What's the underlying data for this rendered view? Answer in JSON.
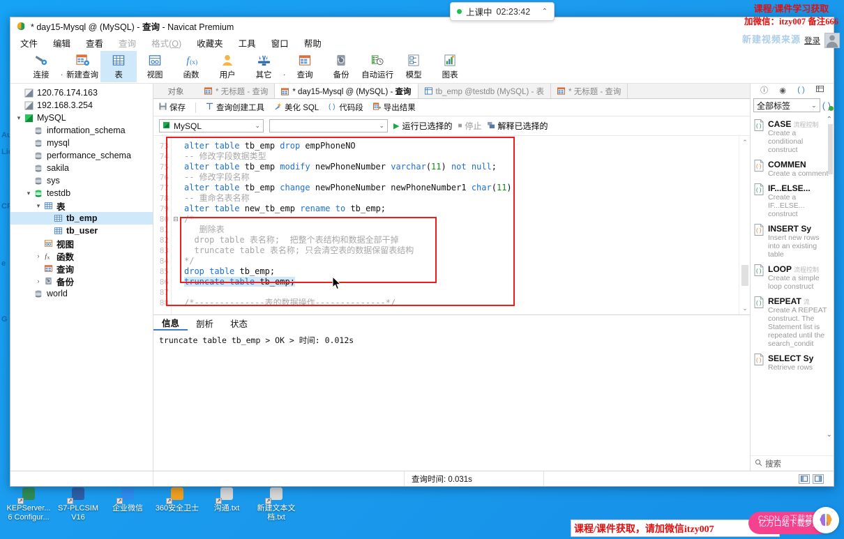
{
  "window": {
    "title_prefix": "* day15-Mysql @ (MySQL) - ",
    "title_mid": "查询",
    "title_suffix": " - Navicat Premium",
    "app_icon": "navicat-icon"
  },
  "menubar": {
    "items": [
      {
        "label": "文件",
        "dim": false
      },
      {
        "label": "编辑",
        "dim": false
      },
      {
        "label": "查看",
        "dim": false
      },
      {
        "label": "查询",
        "dim": true
      },
      {
        "label": "格式(O)",
        "dim": true,
        "underline": "O"
      },
      {
        "label": "收藏夹",
        "dim": false
      },
      {
        "label": "工具",
        "dim": false
      },
      {
        "label": "窗口",
        "dim": false
      },
      {
        "label": "帮助",
        "dim": false
      }
    ]
  },
  "toolbar": {
    "items": [
      {
        "label": "连接",
        "icon": "connection-icon",
        "selected": false,
        "caret": true
      },
      {
        "label": "新建查询",
        "icon": "new-query-icon",
        "selected": false,
        "caret": false
      },
      {
        "label": "表",
        "icon": "table-icon",
        "selected": true,
        "caret": false
      },
      {
        "label": "视图",
        "icon": "view-icon",
        "selected": false,
        "caret": false
      },
      {
        "label": "函数",
        "icon": "function-icon",
        "selected": false,
        "caret": false
      },
      {
        "label": "用户",
        "icon": "user-icon",
        "selected": false,
        "caret": false
      },
      {
        "label": "其它",
        "icon": "other-tools-icon",
        "selected": false,
        "caret": true
      },
      {
        "label": "查询",
        "icon": "query-icon",
        "selected": false,
        "caret": false
      },
      {
        "label": "备份",
        "icon": "backup-icon",
        "selected": false,
        "caret": false
      },
      {
        "label": "自动运行",
        "icon": "automation-icon",
        "selected": false,
        "caret": false
      },
      {
        "label": "模型",
        "icon": "model-icon",
        "selected": false,
        "caret": false
      },
      {
        "label": "图表",
        "icon": "chart-icon",
        "selected": false,
        "caret": false
      }
    ]
  },
  "sidebar": {
    "tree": [
      {
        "label": "120.76.174.163",
        "depth": 0,
        "arrow": "",
        "icon": "connection-gray-icon",
        "selected": false,
        "bold": false
      },
      {
        "label": "192.168.3.254",
        "depth": 0,
        "arrow": "",
        "icon": "connection-gray-icon",
        "selected": false,
        "bold": false
      },
      {
        "label": "MySQL",
        "depth": 0,
        "arrow": "▾",
        "icon": "connection-green-icon",
        "selected": false,
        "bold": false
      },
      {
        "label": "information_schema",
        "depth": 1,
        "arrow": "",
        "icon": "database-icon",
        "selected": false,
        "bold": false
      },
      {
        "label": "mysql",
        "depth": 1,
        "arrow": "",
        "icon": "database-icon",
        "selected": false,
        "bold": false
      },
      {
        "label": "performance_schema",
        "depth": 1,
        "arrow": "",
        "icon": "database-icon",
        "selected": false,
        "bold": false
      },
      {
        "label": "sakila",
        "depth": 1,
        "arrow": "",
        "icon": "database-icon",
        "selected": false,
        "bold": false
      },
      {
        "label": "sys",
        "depth": 1,
        "arrow": "",
        "icon": "database-icon",
        "selected": false,
        "bold": false
      },
      {
        "label": "testdb",
        "depth": 1,
        "arrow": "▾",
        "icon": "database-open-icon",
        "selected": false,
        "bold": false
      },
      {
        "label": "表",
        "depth": 2,
        "arrow": "▾",
        "icon": "table-folder-icon",
        "selected": false,
        "bold": true
      },
      {
        "label": "tb_emp",
        "depth": 3,
        "arrow": "",
        "icon": "table-icon",
        "selected": true,
        "bold": true
      },
      {
        "label": "tb_user",
        "depth": 3,
        "arrow": "",
        "icon": "table-icon",
        "selected": false,
        "bold": true
      },
      {
        "label": "视图",
        "depth": 2,
        "arrow": "",
        "icon": "view-folder-icon",
        "selected": false,
        "bold": true
      },
      {
        "label": "函数",
        "depth": 2,
        "arrow": "›",
        "icon": "fx-icon",
        "selected": false,
        "bold": true
      },
      {
        "label": "查询",
        "depth": 2,
        "arrow": "",
        "icon": "query-folder-icon",
        "selected": false,
        "bold": true
      },
      {
        "label": "备份",
        "depth": 2,
        "arrow": "›",
        "icon": "backup-folder-icon",
        "selected": false,
        "bold": true
      },
      {
        "label": "world",
        "depth": 1,
        "arrow": "",
        "icon": "database-icon",
        "selected": false,
        "bold": false
      }
    ]
  },
  "tabstrip": {
    "object_label": "对象",
    "tabs": [
      {
        "label": "* 无标题 - 查询",
        "active": false,
        "icon": "query-tab-icon"
      },
      {
        "label": "* day15-Mysql @ (MySQL) - 查询",
        "active": true,
        "icon": "query-tab-icon"
      },
      {
        "label": "tb_emp @testdb (MySQL) - 表",
        "active": false,
        "icon": "table-tab-icon"
      },
      {
        "label": "* 无标题 - 查询",
        "active": false,
        "icon": "query-tab-icon"
      }
    ]
  },
  "query_toolbar": {
    "buttons": [
      {
        "label": "保存",
        "icon": "save-icon"
      },
      {
        "label": "查询创建工具",
        "icon": "query-builder-icon"
      },
      {
        "label": "美化 SQL",
        "icon": "beautify-icon"
      },
      {
        "label": "代码段",
        "icon": "snippet-icon"
      },
      {
        "label": "导出结果",
        "icon": "export-icon"
      }
    ]
  },
  "conn_bar": {
    "connection": "MySQL",
    "database": "",
    "run_label": "运行已选择的",
    "stop_label": "停止",
    "explain_label": "解释已选择的"
  },
  "editor": {
    "first_line_number": 73,
    "lines": [
      {
        "n": 73,
        "fold": "",
        "tokens": [
          {
            "t": "alter",
            "c": "kw"
          },
          {
            "t": " ",
            "c": ""
          },
          {
            "t": "table",
            "c": "kw"
          },
          {
            "t": " tb_emp ",
            "c": ""
          },
          {
            "t": "drop",
            "c": "kw"
          },
          {
            "t": " empPhoneNO",
            "c": ""
          }
        ]
      },
      {
        "n": 74,
        "fold": "",
        "tokens": [
          {
            "t": "-- 修改字段数据类型",
            "c": "cm"
          }
        ]
      },
      {
        "n": 75,
        "fold": "",
        "tokens": [
          {
            "t": "alter",
            "c": "kw"
          },
          {
            "t": " ",
            "c": ""
          },
          {
            "t": "table",
            "c": "kw"
          },
          {
            "t": " tb_emp ",
            "c": ""
          },
          {
            "t": "modify",
            "c": "kw"
          },
          {
            "t": " newPhoneNumber ",
            "c": ""
          },
          {
            "t": "varchar",
            "c": "kw"
          },
          {
            "t": "(",
            "c": ""
          },
          {
            "t": "11",
            "c": "num"
          },
          {
            "t": ") ",
            "c": ""
          },
          {
            "t": "not",
            "c": "kw"
          },
          {
            "t": " ",
            "c": ""
          },
          {
            "t": "null",
            "c": "kw"
          },
          {
            "t": ";",
            "c": ""
          }
        ]
      },
      {
        "n": 76,
        "fold": "",
        "tokens": [
          {
            "t": "-- 修改字段名称",
            "c": "cm"
          }
        ]
      },
      {
        "n": 77,
        "fold": "",
        "tokens": [
          {
            "t": "alter",
            "c": "kw"
          },
          {
            "t": " ",
            "c": ""
          },
          {
            "t": "table",
            "c": "kw"
          },
          {
            "t": " tb_emp ",
            "c": ""
          },
          {
            "t": "change",
            "c": "kw"
          },
          {
            "t": " newPhoneNumber newPhoneNumber1 ",
            "c": ""
          },
          {
            "t": "char",
            "c": "kw"
          },
          {
            "t": "(",
            "c": ""
          },
          {
            "t": "11",
            "c": "num"
          },
          {
            "t": ");",
            "c": ""
          }
        ]
      },
      {
        "n": 78,
        "fold": "",
        "tokens": [
          {
            "t": "-- 重命名表名称",
            "c": "cm"
          }
        ]
      },
      {
        "n": 79,
        "fold": "",
        "tokens": [
          {
            "t": "alter",
            "c": "kw"
          },
          {
            "t": " ",
            "c": ""
          },
          {
            "t": "table",
            "c": "kw"
          },
          {
            "t": " new_tb_emp ",
            "c": ""
          },
          {
            "t": "rename",
            "c": "kw"
          },
          {
            "t": " ",
            "c": ""
          },
          {
            "t": "to",
            "c": "kw"
          },
          {
            "t": " tb_emp;",
            "c": ""
          }
        ]
      },
      {
        "n": 80,
        "fold": "⊟",
        "tokens": [
          {
            "t": "/*",
            "c": "cm"
          }
        ]
      },
      {
        "n": 81,
        "fold": "",
        "tokens": [
          {
            "t": "   删除表",
            "c": "cm"
          }
        ]
      },
      {
        "n": 82,
        "fold": "",
        "tokens": [
          {
            "t": "  drop table 表名称;  把整个表结构和数据全部干掉",
            "c": "cm"
          }
        ]
      },
      {
        "n": 83,
        "fold": "",
        "tokens": [
          {
            "t": "  truncate table 表名称; 只会清空表的数据保留表结构",
            "c": "cm"
          }
        ]
      },
      {
        "n": 84,
        "fold": "",
        "tokens": [
          {
            "t": "*/",
            "c": "cm"
          }
        ]
      },
      {
        "n": 85,
        "fold": "",
        "tokens": [
          {
            "t": "drop",
            "c": "kw"
          },
          {
            "t": " ",
            "c": ""
          },
          {
            "t": "table",
            "c": "kw"
          },
          {
            "t": " tb_emp;",
            "c": ""
          }
        ]
      },
      {
        "n": 86,
        "fold": "",
        "highlight": true,
        "tokens": [
          {
            "t": "truncate",
            "c": "kw"
          },
          {
            "t": " ",
            "c": ""
          },
          {
            "t": "table",
            "c": "kw"
          },
          {
            "t": " tb_emp;",
            "c": ""
          }
        ]
      },
      {
        "n": 87,
        "fold": "",
        "tokens": [
          {
            "t": "",
            "c": ""
          }
        ]
      },
      {
        "n": 88,
        "fold": "",
        "tokens": [
          {
            "t": "/*--------------表的数据操作--------------*/",
            "c": "cm"
          }
        ]
      }
    ]
  },
  "results": {
    "tabs": [
      {
        "label": "信息",
        "active": true
      },
      {
        "label": "剖析",
        "active": false
      },
      {
        "label": "状态",
        "active": false
      }
    ],
    "output": "truncate table tb_emp\n> OK\n> 时间: 0.012s"
  },
  "right_panel": {
    "top_icons": [
      "info-icon",
      "eye-icon",
      "code-paren-icon",
      "grid-icon"
    ],
    "filter_label": "全部标签",
    "add_icon": "add-snippet-icon",
    "search_placeholder": "搜索",
    "search_icon": "search-icon",
    "snippets": [
      {
        "title": "CASE",
        "badge": "流程控制",
        "desc": "Create a conditional construct",
        "icon": "snippet-green-icon"
      },
      {
        "title": "COMMEN",
        "badge": "",
        "desc": "Create a comment",
        "icon": "snippet-orange-icon"
      },
      {
        "title": "IF...ELSE...",
        "badge": "",
        "desc": "Create a IF...ELSE... construct",
        "icon": "snippet-green-icon"
      },
      {
        "title": "INSERT Sy",
        "badge": "",
        "desc": "Insert new rows into an existing table",
        "icon": "snippet-orange-icon"
      },
      {
        "title": "LOOP",
        "badge": "流程控制",
        "desc": "Create a simple loop construct",
        "icon": "snippet-green-icon"
      },
      {
        "title": "REPEAT",
        "badge": "流",
        "desc": "Create A REPEAT construct. The Statement list is repeated until the search_condit",
        "icon": "snippet-green-icon"
      },
      {
        "title": "SELECT Sy",
        "badge": "",
        "desc": "Retrieve rows",
        "icon": "snippet-orange-icon"
      }
    ]
  },
  "statusbar": {
    "query_time_label": "查询时间: 0.031s",
    "view_buttons": [
      "split-horizontal-icon",
      "split-vertical-icon"
    ]
  },
  "overlays": {
    "class_widget": {
      "label": "上课中",
      "time": "02:23:42",
      "caret": "⌃"
    },
    "promo_top_line1": "课程/课件学习获取",
    "promo_top_line2": "加微信：itzy007 备注666",
    "ghost_text": "新建视频来源",
    "login_label": "登录",
    "promo_bottom": "课程/课件获取，请加微信itzy007",
    "pink_widget_front": "亿万口站下载梦野",
    "pink_widget_back": "CSDN @下载梦野"
  },
  "desktop": {
    "icons": [
      {
        "line1": "KEPServer...",
        "line2": "6 Configur...",
        "color": "#2e8b57"
      },
      {
        "line1": "S7-PLCSIM",
        "line2": "V16",
        "color": "#2c5fa8"
      },
      {
        "line1": "企业微信",
        "line2": "",
        "color": "#2d8cf0"
      },
      {
        "line1": "360安全卫士",
        "line2": "",
        "color": "#f0a020"
      },
      {
        "line1": "沟通.txt",
        "line2": "",
        "color": "#d8d8d8"
      },
      {
        "line1": "新建文本文",
        "line2": "档.txt",
        "color": "#d8d8d8"
      }
    ],
    "side_text": [
      "Au",
      "Lic",
      "CP",
      "e",
      "G"
    ]
  }
}
